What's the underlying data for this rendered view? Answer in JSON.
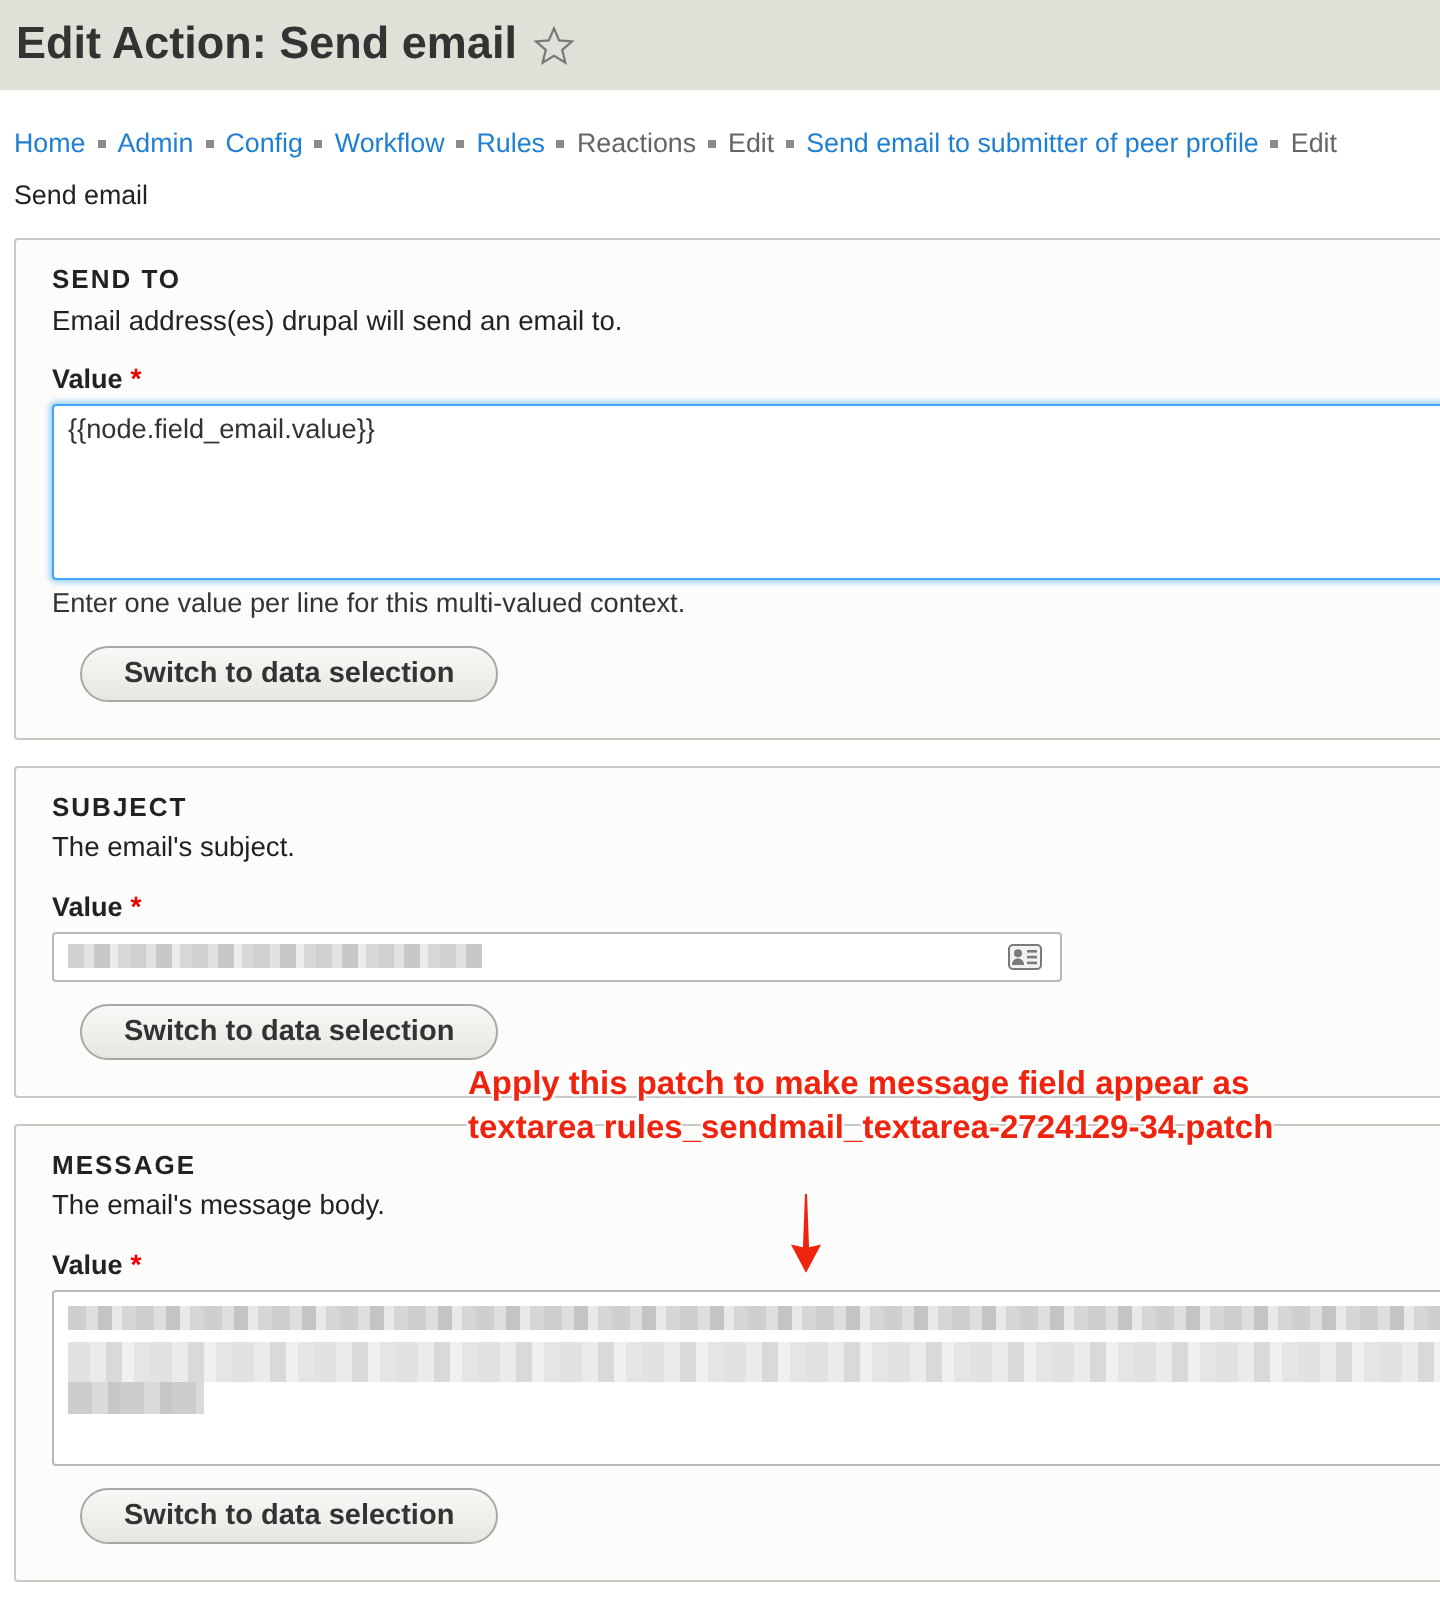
{
  "page": {
    "title": "Edit Action: Send email",
    "starred": false
  },
  "breadcrumb": [
    {
      "label": "Home",
      "kind": "link"
    },
    {
      "label": "Admin",
      "kind": "link"
    },
    {
      "label": "Config",
      "kind": "link"
    },
    {
      "label": "Workflow",
      "kind": "link"
    },
    {
      "label": "Rules",
      "kind": "link"
    },
    {
      "label": "Reactions",
      "kind": "text"
    },
    {
      "label": "Edit",
      "kind": "text"
    },
    {
      "label": "Send email to submitter of peer profile",
      "kind": "link"
    },
    {
      "label": "Edit",
      "kind": "text"
    }
  ],
  "subtitle": "Send email",
  "sections": [
    {
      "kind": "textarea",
      "legend": "SEND TO",
      "description": "Email address(es) drupal will send an email to.",
      "label": "Value",
      "required_mark": "*",
      "value": "{{node.field_email.value}}",
      "redacted": false,
      "focused": true,
      "help": "Enter one value per line for this multi-valued context.",
      "button": "Switch to data selection"
    },
    {
      "kind": "input",
      "legend": "SUBJECT",
      "description": "The email's subject.",
      "label": "Value",
      "required_mark": "*",
      "redacted": true,
      "focused": false,
      "button": "Switch to data selection"
    },
    {
      "kind": "textarea",
      "legend": "MESSAGE",
      "description": "The email's message body.",
      "label": "Value",
      "required_mark": "*",
      "redacted": true,
      "focused": false,
      "button": "Switch to data selection"
    }
  ],
  "annotation": {
    "lines": [
      "Apply this patch to make message field appear as",
      "textarea rules_sendmail_textarea-2724129-34.patch"
    ]
  }
}
